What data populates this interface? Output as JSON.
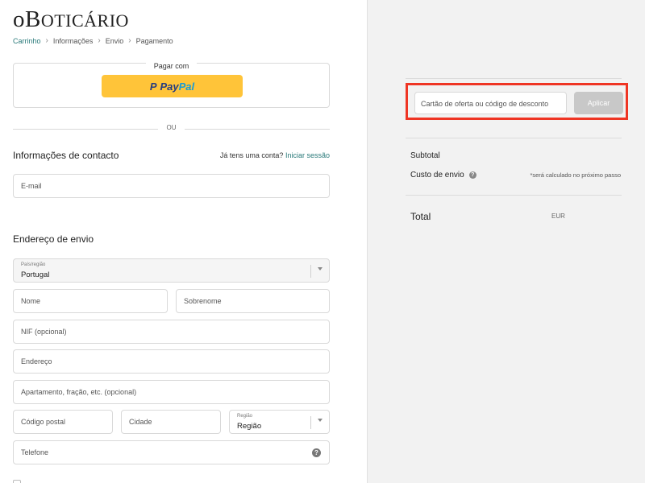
{
  "brand": {
    "logo_text": "oBoticário",
    "logo_o": "o",
    "logo_b": "B",
    "logo_rest": "OTICÁRIO"
  },
  "breadcrumb": [
    "Carrinho",
    "Informações",
    "Envio",
    "Pagamento"
  ],
  "express": {
    "title": "Pagar com",
    "paypal_p": "P",
    "paypal_pay": "Pay",
    "paypal_pal": "Pal"
  },
  "divider": {
    "or": "OU"
  },
  "contact": {
    "title": "Informações de contacto",
    "login_question": "Já tens uma conta?",
    "login_link": "Iniciar sessão",
    "email_placeholder": "E-mail"
  },
  "shipping": {
    "title": "Endereço de envio",
    "country_label": "País/região",
    "country_value": "Portugal",
    "first_name": "Nome",
    "last_name": "Sobrenome",
    "nif": "NIF (opcional)",
    "address": "Endereço",
    "apartment": "Apartamento, fração, etc. (opcional)",
    "postal_code": "Código postal",
    "city": "Cidade",
    "region_label": "Região",
    "region_value": "Região",
    "phone": "Telefone",
    "help_glyph": "?"
  },
  "summary": {
    "discount_placeholder": "Cartão de oferta ou código de desconto",
    "apply_label": "Aplicar",
    "subtotal_label": "Subtotal",
    "shipping_label": "Custo de envio",
    "shipping_note": "*será calculado no próximo passo",
    "total_label": "Total",
    "currency": "EUR"
  },
  "colors": {
    "highlight": "#ef3524",
    "paypal_yellow": "#ffc439",
    "link": "#2a7a7a"
  }
}
